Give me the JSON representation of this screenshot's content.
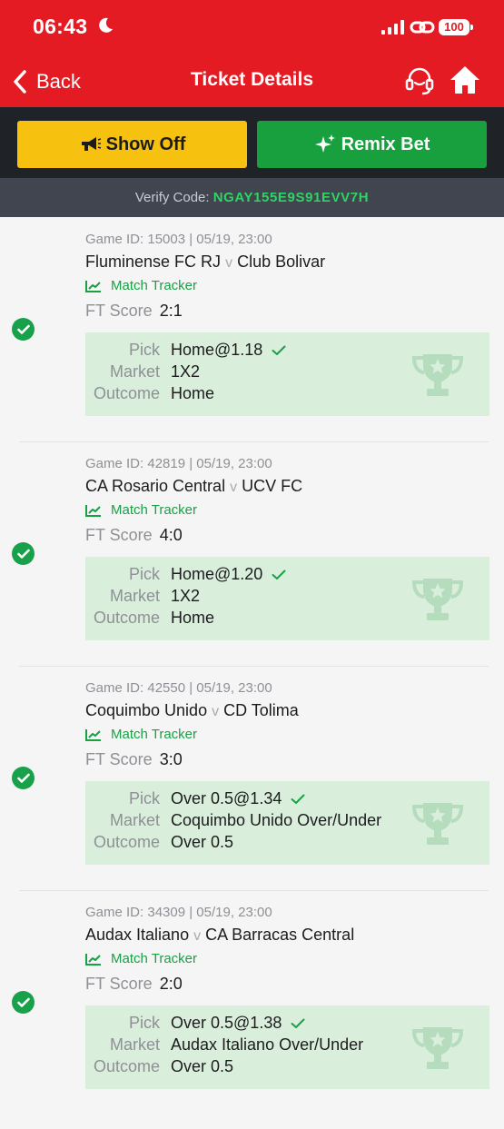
{
  "status": {
    "time": "06:43",
    "battery": "100"
  },
  "nav": {
    "back_label": "Back",
    "title": "Ticket Details"
  },
  "actions": {
    "show_off": "Show Off",
    "remix_bet": "Remix Bet"
  },
  "verify": {
    "label": "Verify Code:",
    "code": "NGAY155E9S91EVV7H"
  },
  "labels": {
    "tracker": "Match Tracker",
    "ft_score": "FT Score",
    "pick": "Pick",
    "market": "Market",
    "outcome": "Outcome",
    "vs": "v"
  },
  "colors": {
    "header": "#e41b23",
    "show_off": "#f7c20f",
    "remix": "#17a03d",
    "win": "#18a14a",
    "pick_bg": "#daeedc",
    "verify_code": "#2fd465"
  },
  "tickets": [
    {
      "meta": "Game ID: 15003 | 05/19, 23:00",
      "home": "Fluminense FC RJ",
      "away": "Club Bolivar",
      "score": "2:1",
      "pick": "Home@1.18",
      "market": "1X2",
      "outcome": "Home",
      "status": "won"
    },
    {
      "meta": "Game ID: 42819 | 05/19, 23:00",
      "home": "CA Rosario Central",
      "away": "UCV FC",
      "score": "4:0",
      "pick": "Home@1.20",
      "market": "1X2",
      "outcome": "Home",
      "status": "won"
    },
    {
      "meta": "Game ID: 42550 | 05/19, 23:00",
      "home": "Coquimbo Unido",
      "away": "CD Tolima",
      "score": "3:0",
      "pick": "Over 0.5@1.34",
      "market": "Coquimbo Unido Over/Under",
      "outcome": "Over 0.5",
      "status": "won"
    },
    {
      "meta": "Game ID: 34309 | 05/19, 23:00",
      "home": "Audax Italiano",
      "away": "CA Barracas Central",
      "score": "2:0",
      "pick": "Over 0.5@1.38",
      "market": "Audax Italiano Over/Under",
      "outcome": "Over 0.5",
      "status": "won"
    }
  ]
}
